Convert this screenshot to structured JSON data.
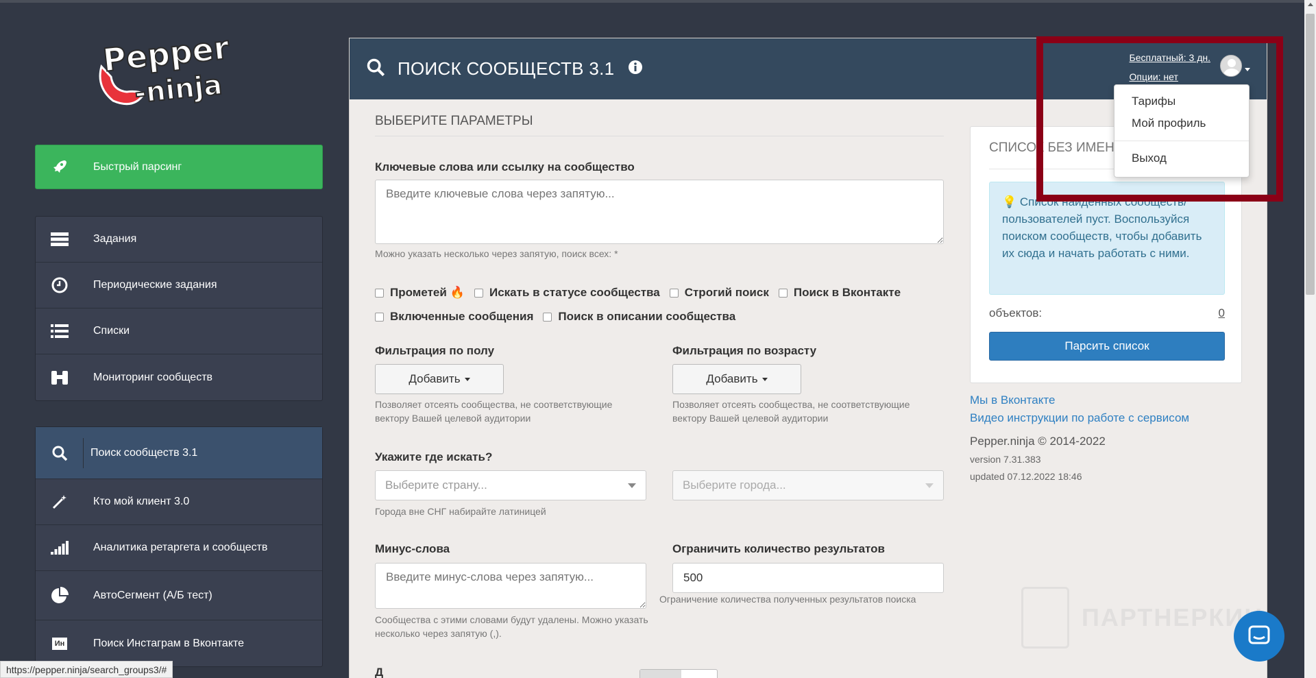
{
  "logo": {
    "line1": "Pepper",
    "line2": "-ninja"
  },
  "sidebar": {
    "quick_parse": "Быстрый парсинг",
    "group1": [
      {
        "label": "Задания",
        "icon": "server-icon"
      },
      {
        "label": "Периодические задания",
        "icon": "clock-icon"
      },
      {
        "label": "Списки",
        "icon": "list-icon"
      },
      {
        "label": "Мониторинг сообществ",
        "icon": "binoculars-icon"
      }
    ],
    "group2": [
      {
        "label": "Поиск сообществ 3.1",
        "icon": "search-icon"
      },
      {
        "label": "Кто мой клиент 3.0",
        "icon": "magic-wand-icon"
      },
      {
        "label": "Аналитика ретаргета и сообществ",
        "icon": "signal-bars-icon"
      },
      {
        "label": "АвтоСегмент (А/Б тест)",
        "icon": "pie-chart-icon"
      },
      {
        "label": "Поиск Инстаграм в Вконтакте",
        "icon": "instagram-vk-icon",
        "icon_text": "Ин"
      }
    ]
  },
  "header": {
    "title": "ПОИСК СООБЩЕСТВ 3.1",
    "plan_link": "Бесплатный: 3 дн.",
    "options_link": "Опции: нет"
  },
  "user_menu": {
    "items": [
      "Тарифы",
      "Мой профиль"
    ],
    "logout": "Выход"
  },
  "form": {
    "section_title": "ВЫБЕРИТЕ ПАРАМЕТРЫ",
    "keywords_label": "Ключевые слова или ссылку на сообщество",
    "keywords_placeholder": "Введите ключевые слова через запятую...",
    "keywords_help": "Можно указать несколько через запятую, поиск всех: *",
    "checkboxes_row1": [
      "Прометей",
      "Искать в статусе сообщества",
      "Строгий поиск",
      "Поиск в Вконтакте"
    ],
    "checkboxes_row2": [
      "Включенные сообщения",
      "Поиск в описании сообщества"
    ],
    "gender_label": "Фильтрация по полу",
    "age_label": "Фильтрация по возрасту",
    "add_button": "Добавить",
    "filter_help": "Позволяет отсеять сообщества, не соответствующие вектору Вашей целевой аудитории",
    "where_label": "Укажите где искать?",
    "country_placeholder": "Выберите страну...",
    "city_placeholder": "Выберите города...",
    "country_help": "Города вне СНГ набирайте латиницей",
    "minus_label": "Минус-слова",
    "minus_placeholder": "Введите минус-слова через запятую...",
    "minus_help": "Сообщества с этими словами будут удалены. Можно указать несколько через запятую (,).",
    "limit_label": "Ограничить количество результатов",
    "limit_value": "500",
    "limit_help": "Ограничение количества полученных результатов поиска",
    "bottom_partial": "Д"
  },
  "list_panel": {
    "title": "СПИСОК БЕЗ ИМЕНИ",
    "notice": "Список найденных сообществ/пользователей пуст. Воспользуйся поиском сообществ, чтобы добавить их сюда и начать работать с ними.",
    "objects_label": "объектов:",
    "objects_count": "0",
    "parse_button": "Парсить список"
  },
  "links": {
    "vk": "Мы в Вконтакте",
    "video": "Видео инструкции по работе с сервисом"
  },
  "footer": {
    "copyright": "Pepper.ninja © 2014-2022",
    "version": "version 7.31.383",
    "updated": "updated 07.12.2022 18:46"
  },
  "watermark": "ПАРТНЕРКИН",
  "status_url": "https://pepper.ninja/search_groups3/#",
  "colors": {
    "sidebar": "#323845",
    "header": "#34495e",
    "green": "#3bb55c",
    "primary": "#2e7ebf",
    "highlight": "#8b0016"
  }
}
